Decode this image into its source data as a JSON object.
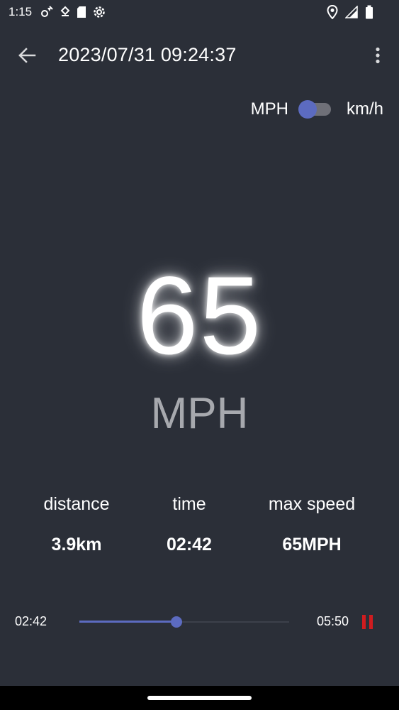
{
  "status_bar": {
    "time": "1:15",
    "icons_left": [
      "settings-broadcast-icon",
      "vpn-key-icon",
      "sd-card-icon",
      "settings-gear-icon"
    ],
    "icons_right": [
      "location-pin-icon",
      "signal-icon",
      "battery-icon"
    ]
  },
  "app_bar": {
    "title": "2023/07/31 09:24:37",
    "back_icon": "arrow-back-icon",
    "overflow_icon": "more-vert-icon"
  },
  "unit_toggle": {
    "left_label": "MPH",
    "right_label": "km/h",
    "state": "MPH"
  },
  "speed": {
    "value": "65",
    "unit": "MPH"
  },
  "stats": [
    {
      "label": "distance",
      "value": "3.9km"
    },
    {
      "label": "time",
      "value": "02:42"
    },
    {
      "label": "max speed",
      "value": "65MPH"
    }
  ],
  "playback": {
    "current_time": "02:42",
    "total_time": "05:50",
    "progress_fraction": 0.4629,
    "pause_icon": "pause-icon"
  },
  "colors": {
    "background": "#2b2f38",
    "accent": "#5c6bc0",
    "pause": "#d01c1f",
    "muted_text": "#a7a9ae"
  }
}
